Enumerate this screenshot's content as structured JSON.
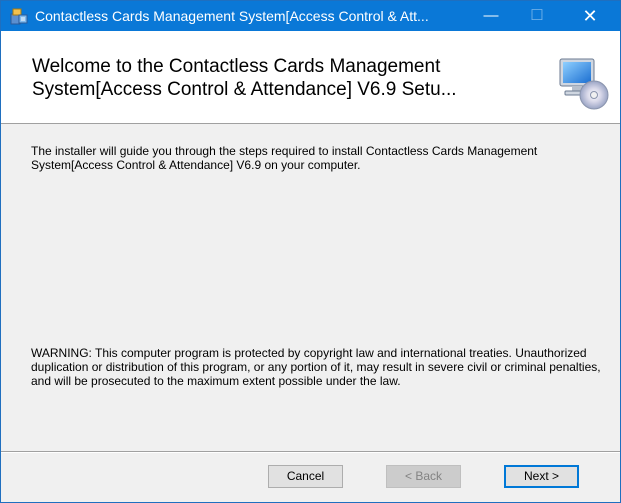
{
  "window": {
    "title": "Contactless Cards Management System[Access Control & Att...",
    "minimize_glyph": "—",
    "maximize_glyph": "☐",
    "close_glyph": "✕"
  },
  "banner": {
    "title": "Welcome to the Contactless Cards Management System[Access Control & Attendance] V6.9 Setu...",
    "icon": "computer-with-cd-icon"
  },
  "body": {
    "intro": "The installer will guide you through the steps required to install Contactless Cards Management System[Access Control & Attendance] V6.9 on your computer.",
    "warning": "WARNING: This computer program is protected by copyright law and international treaties. Unauthorized duplication or distribution of this program, or any portion of it, may result in severe civil or criminal penalties, and will be prosecuted to the maximum extent possible under the law."
  },
  "buttons": {
    "cancel": "Cancel",
    "back": "< Back",
    "next": "Next >"
  },
  "colors": {
    "titlebar": "#0a78d7",
    "dialog_bg": "#f0f0f0",
    "banner_bg": "#ffffff",
    "focus_border": "#0078d7"
  }
}
